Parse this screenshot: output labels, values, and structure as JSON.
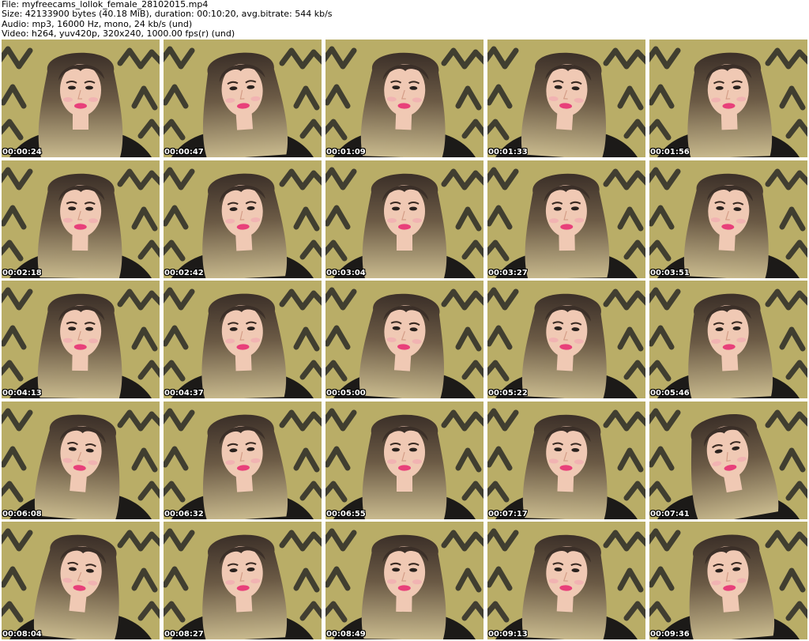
{
  "header": {
    "file_line": "File: myfreecams_lollok_female_28102015.mp4",
    "size_line": "Size: 42133900 bytes (40.18 MiB), duration: 00:10:20, avg.bitrate: 544 kb/s",
    "audio_line": "Audio: mp3, 16000 Hz, mono, 24 kb/s (und)",
    "video_line": "Video: h264, yuv420p, 320x240, 1000.00 fps(r) (und)"
  },
  "thumbnails": [
    {
      "timestamp": "00:00:24",
      "head_tilt": 0
    },
    {
      "timestamp": "00:00:47",
      "head_tilt": -4
    },
    {
      "timestamp": "00:01:09",
      "head_tilt": 2
    },
    {
      "timestamp": "00:01:33",
      "head_tilt": 4
    },
    {
      "timestamp": "00:01:56",
      "head_tilt": -2
    },
    {
      "timestamp": "00:02:18",
      "head_tilt": 1
    },
    {
      "timestamp": "00:02:42",
      "head_tilt": -3
    },
    {
      "timestamp": "00:03:04",
      "head_tilt": 0
    },
    {
      "timestamp": "00:03:27",
      "head_tilt": -1
    },
    {
      "timestamp": "00:03:51",
      "head_tilt": 3
    },
    {
      "timestamp": "00:04:13",
      "head_tilt": 1
    },
    {
      "timestamp": "00:04:37",
      "head_tilt": -2
    },
    {
      "timestamp": "00:05:00",
      "head_tilt": 4
    },
    {
      "timestamp": "00:05:22",
      "head_tilt": 3
    },
    {
      "timestamp": "00:05:46",
      "head_tilt": -3
    },
    {
      "timestamp": "00:06:08",
      "head_tilt": 5
    },
    {
      "timestamp": "00:06:32",
      "head_tilt": -4
    },
    {
      "timestamp": "00:06:55",
      "head_tilt": 0
    },
    {
      "timestamp": "00:07:17",
      "head_tilt": 2
    },
    {
      "timestamp": "00:07:41",
      "head_tilt": -10
    },
    {
      "timestamp": "00:08:04",
      "head_tilt": 6
    },
    {
      "timestamp": "00:08:27",
      "head_tilt": -3
    },
    {
      "timestamp": "00:08:49",
      "head_tilt": 1
    },
    {
      "timestamp": "00:09:13",
      "head_tilt": 3
    },
    {
      "timestamp": "00:09:36",
      "head_tilt": -5
    }
  ],
  "colors": {
    "wall": "#b9ad67",
    "stripe": "#34322b",
    "hair_dark": "#3b2f28",
    "hair_light": "#c8b98d",
    "skin": "#f0c9b4",
    "lips": "#e8407a",
    "shirt": "#1c1a18",
    "timestamp_text": "#ffffff"
  }
}
